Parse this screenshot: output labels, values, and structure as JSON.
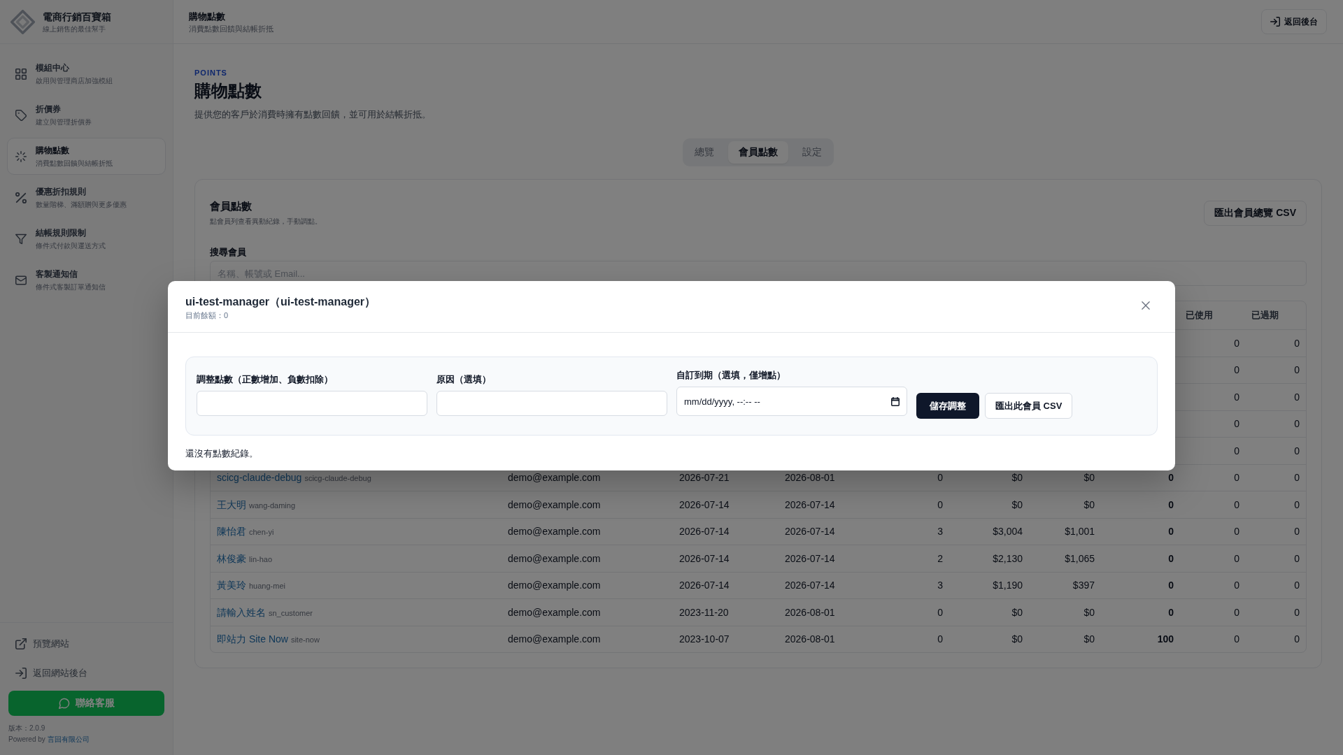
{
  "sidebar": {
    "brand": {
      "title": "電商行銷百寶箱",
      "subtitle": "線上銷售的最佳幫手"
    },
    "items": [
      {
        "title": "模組中心",
        "subtitle": "啟用與管理商店加強模組",
        "selected": false
      },
      {
        "title": "折價券",
        "subtitle": "建立與管理折價券",
        "selected": false
      },
      {
        "title": "購物點數",
        "subtitle": "消費點數回饋與結帳折抵",
        "selected": true
      },
      {
        "title": "優惠折扣規則",
        "subtitle": "數量階梯、滿額贈與更多優惠",
        "selected": false
      },
      {
        "title": "結帳規則限制",
        "subtitle": "條件式付款與運送方式",
        "selected": false
      },
      {
        "title": "客製通知信",
        "subtitle": "條件式客製訂單通知信",
        "selected": false
      }
    ],
    "footer_links": [
      "預覽網站",
      "返回網站後台"
    ],
    "contact_button": "聯絡客服",
    "version": "版本：2.0.9",
    "powered_by": {
      "text": "Powered by",
      "company": "言回有限公司"
    }
  },
  "topbar": {
    "title": "購物點數",
    "subtitle": "消費點數回饋與結帳折抵",
    "back_button": "返回後台"
  },
  "page": {
    "eyebrow": "POINTS",
    "title": "購物點數",
    "description": "提供您的客戶於消費時擁有點數回饋，並可用於結帳折抵。"
  },
  "tabs": [
    {
      "label": "總覽",
      "selected": false
    },
    {
      "label": "會員點數",
      "selected": true
    },
    {
      "label": "設定",
      "selected": false
    }
  ],
  "card": {
    "title": "會員點數",
    "subtitle": "點會員列查看異動紀錄，手動調點。",
    "export_button": "匯出會員總覽 CSV",
    "search": {
      "label": "搜尋會員",
      "placeholder": "名稱、帳號或 Email..."
    }
  },
  "table": {
    "columns": [
      "已使用",
      "已過期"
    ],
    "rows": [
      {
        "used": "0",
        "expired": "0"
      },
      {
        "used": "0",
        "expired": "0"
      },
      {
        "used": "0",
        "expired": "0"
      },
      {
        "used": "0",
        "expired": "0"
      },
      {
        "used": "0",
        "expired": "0"
      },
      {
        "name": "scicg-claude-debug",
        "handle": "scicg-claude-debug",
        "email": "demo@example.com",
        "column_3": "2026-07-21",
        "column_4": "2026-08-01",
        "column_5": "0",
        "column_6": "$0",
        "column_7": "$0",
        "column_8": "0",
        "used": "0",
        "expired": "0"
      },
      {
        "name": "王大明",
        "handle": "wang-daming",
        "email": "demo@example.com",
        "column_3": "2026-07-14",
        "column_4": "2026-07-14",
        "column_5": "0",
        "column_6": "$0",
        "column_7": "$0",
        "column_8": "0",
        "used": "0",
        "expired": "0"
      },
      {
        "name": "陳怡君",
        "handle": "chen-yi",
        "email": "demo@example.com",
        "column_3": "2026-07-14",
        "column_4": "2026-07-14",
        "column_5": "3",
        "column_6": "$3,004",
        "column_7": "$1,001",
        "column_8": "0",
        "used": "0",
        "expired": "0"
      },
      {
        "name": "林俊豪",
        "handle": "lin-hao",
        "email": "demo@example.com",
        "column_3": "2026-07-14",
        "column_4": "2026-07-14",
        "column_5": "2",
        "column_6": "$2,130",
        "column_7": "$1,065",
        "column_8": "0",
        "used": "0",
        "expired": "0"
      },
      {
        "name": "黃美玲",
        "handle": "huang-mei",
        "email": "demo@example.com",
        "column_3": "2026-07-14",
        "column_4": "2026-07-14",
        "column_5": "3",
        "column_6": "$1,190",
        "column_7": "$397",
        "column_8": "0",
        "used": "0",
        "expired": "0"
      },
      {
        "name": "請輸入姓名",
        "handle": "sn_customer",
        "email": "demo@example.com",
        "column_3": "2023-11-20",
        "column_4": "2026-08-01",
        "column_5": "0",
        "column_6": "$0",
        "column_7": "$0",
        "column_8": "0",
        "used": "0",
        "expired": "0"
      },
      {
        "name": "即站力 Site Now",
        "handle": "site-now",
        "email": "demo@example.com",
        "column_3": "2023-10-07",
        "column_4": "2026-08-01",
        "column_5": "0",
        "column_6": "$0",
        "column_7": "$0",
        "column_8": "100",
        "used": "0",
        "expired": "0"
      }
    ]
  },
  "modal": {
    "open": true,
    "title": "ui-test-manager（ui-test-manager）",
    "balance": "目前餘額：0",
    "fields": [
      {
        "kind": "text",
        "label": "調整點數（正數增加、負數扣除）"
      },
      {
        "kind": "text",
        "label": "原因（選填）"
      },
      {
        "kind": "datetime",
        "label": "自訂到期（選填，僅增點）",
        "placeholder": "mm/dd/yyyy, --:-- --"
      }
    ],
    "save_button": "儲存調整",
    "export_button": "匯出此會員 CSV",
    "empty_text": "還沒有點數紀錄。"
  }
}
